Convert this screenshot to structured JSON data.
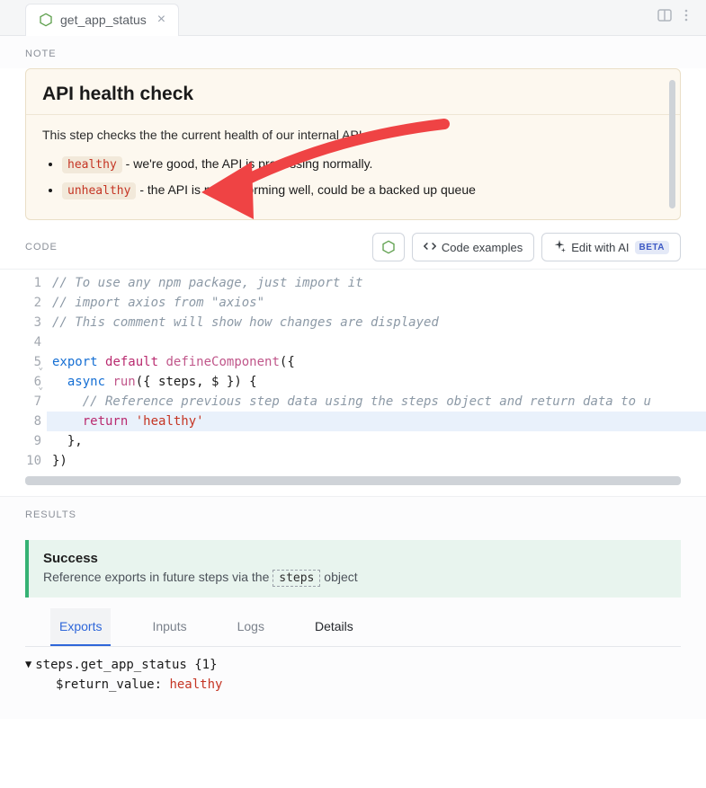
{
  "tab": {
    "title": "get_app_status"
  },
  "sections": {
    "note": "NOTE",
    "code": "CODE",
    "results": "RESULTS"
  },
  "note": {
    "title": "API health check",
    "description": "This step checks the the current health of our internal API.",
    "items": [
      {
        "code": "healthy",
        "text": " - we're good, the API is processing normally."
      },
      {
        "code": "unhealthy",
        "text": " - the API is not performing well, could be a backed up queue"
      }
    ]
  },
  "code_buttons": {
    "examples": "Code examples",
    "edit_ai": "Edit with AI",
    "beta": "BETA"
  },
  "code": {
    "l1": "// To use any npm package, just import it",
    "l2": "// import axios from \"axios\"",
    "l3": "// This comment will show how changes are displayed",
    "l5_kw1": "export",
    "l5_kw2": "default",
    "l5_fn": "defineComponent",
    "l5_tail": "({",
    "l6_kw": "async",
    "l6_name": "run",
    "l6_args": "({ steps, $ }) {",
    "l7": "    // Reference previous step data using the steps object and return data to u",
    "l8_kw": "return",
    "l8_str": "'healthy'",
    "l9": "  },",
    "l10": "})"
  },
  "results": {
    "success_title": "Success",
    "success_pre": "Reference exports in future steps via the ",
    "success_chip": "steps",
    "success_post": " object",
    "tabs": {
      "exports": "Exports",
      "inputs": "Inputs",
      "logs": "Logs",
      "details": "Details"
    },
    "exports": {
      "path": "steps.get_app_status",
      "count": "{1}",
      "rv_key": "$return_value:",
      "rv_val": "healthy"
    }
  }
}
